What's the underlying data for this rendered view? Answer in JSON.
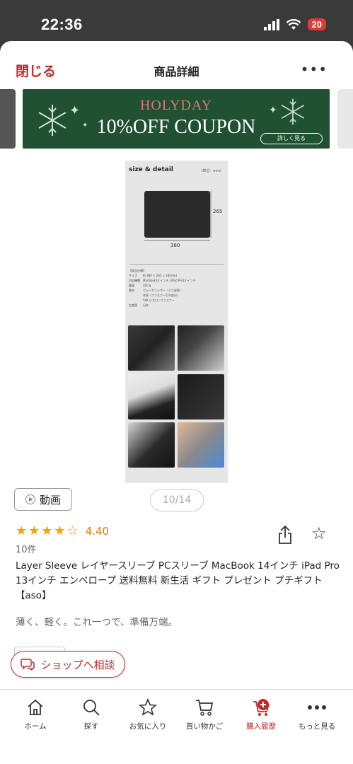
{
  "status": {
    "time": "22:36",
    "battery": "20"
  },
  "header": {
    "close": "閉じる",
    "title": "商品詳細",
    "more": "•••"
  },
  "banner": {
    "line1": "HOLYDAY",
    "line2": "10%OFF COUPON",
    "button": "詳しく見る"
  },
  "product_image": {
    "title": "size & detail",
    "unit": "（単位：mm）",
    "height_dim": "265",
    "width_dim": "380",
    "spec_lines": [
      "【商品仕様】",
      "サイズ　　約 380 × 265 × 10(mm)",
      "対応機種　MacBook14 インチ / iPad Pro13 インチ",
      "重量　　　300 g",
      "素材　　　ヴィーガンレザー（人工皮革）",
      "　　　　　本革（ファスナー引手部分）",
      "　　　　　YKK ビスロンファスナー",
      "生産国　　日本"
    ]
  },
  "video_button": "動画",
  "page_indicator": "10/14",
  "rating": {
    "value": "4.40",
    "stars": 4.5,
    "review_count": "10件"
  },
  "product_title": "Layer Sleeve レイヤースリーブ PCスリーブ MacBook 14インチ iPad Pro 13インチ エンベロープ 送料無料 新生活 ギフト プレゼント プチギフト 【aso】",
  "catchcopy": "薄く、軽く。これ一つで、準備万端。",
  "consult_button": "ショップへ相談",
  "tabs": [
    {
      "label": "ホーム",
      "icon": "home-icon"
    },
    {
      "label": "探す",
      "icon": "search-icon"
    },
    {
      "label": "お気に入り",
      "icon": "star-icon"
    },
    {
      "label": "買い物かご",
      "icon": "cart-icon"
    },
    {
      "label": "購入履歴",
      "icon": "purchase-history-icon"
    },
    {
      "label": "もっと見る",
      "icon": "more-icon"
    }
  ],
  "colors": {
    "accent": "#c62828",
    "banner_bg": "#1f5132",
    "star": "#f4a300"
  }
}
